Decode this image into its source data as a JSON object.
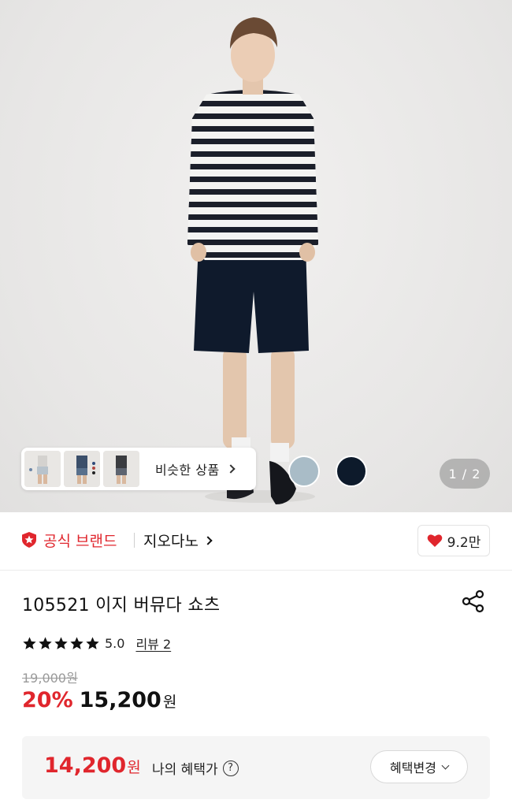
{
  "gallery": {
    "similar_label": "비슷한 상품",
    "page_indicator": "1 / 2",
    "swatches": [
      {
        "name": "grey-blue",
        "color": "#a9bcc7"
      },
      {
        "name": "navy",
        "color": "#0d1a2b"
      }
    ]
  },
  "brand": {
    "official_label": "공식 브랜드",
    "name": "지오다노",
    "like_count": "9.2만",
    "accent_color": "#e0262d"
  },
  "product": {
    "title": "105521 이지 버뮤다 쇼츠",
    "rating": "5.0",
    "stars": 5,
    "review_label": "리뷰 2",
    "original_price": "19,000원",
    "discount": "20%",
    "sale_price": "15,200",
    "sale_unit": "원"
  },
  "benefit": {
    "price": "14,200",
    "unit": "원",
    "label": "나의 혜택가",
    "help_glyph": "?",
    "change_label": "혜택변경"
  }
}
